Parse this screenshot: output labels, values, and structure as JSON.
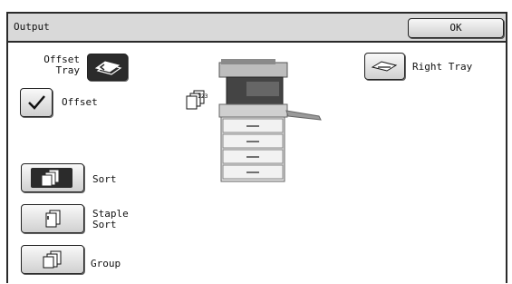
{
  "header": {
    "title": "Output",
    "ok_label": "OK"
  },
  "offset_tray": {
    "label_line1": "Offset",
    "label_line2": "Tray",
    "icon": "offset-tray-icon",
    "selected": true
  },
  "offset": {
    "label": "Offset",
    "checked": true,
    "icon": "checkmark-icon"
  },
  "right_tray": {
    "label": "Right Tray",
    "icon": "tray-icon"
  },
  "sort_modes": [
    {
      "label_line1": "Sort",
      "label_line2": "",
      "icon": "sort-icon",
      "selected": true
    },
    {
      "label_line1": "Staple",
      "label_line2": "Sort",
      "icon": "staple-sort-icon",
      "selected": false
    },
    {
      "label_line1": "Group",
      "label_line2": "",
      "icon": "group-icon",
      "selected": false
    }
  ],
  "preview": {
    "icon": "copier-icon",
    "stack_icon": "collated-stack-icon"
  }
}
